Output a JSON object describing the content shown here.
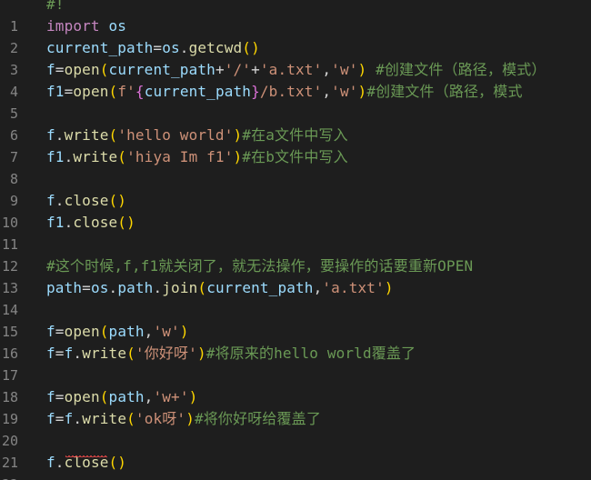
{
  "lines": [
    {
      "num": "",
      "tokens": [
        {
          "t": "#!",
          "c": "cm"
        }
      ]
    },
    {
      "num": "1",
      "tokens": [
        {
          "t": "import",
          "c": "kw"
        },
        {
          "t": " ",
          "c": ""
        },
        {
          "t": "os",
          "c": "var"
        }
      ]
    },
    {
      "num": "2",
      "tokens": [
        {
          "t": "current_path",
          "c": "var"
        },
        {
          "t": "=",
          "c": ""
        },
        {
          "t": "os",
          "c": "var"
        },
        {
          "t": ".",
          "c": ""
        },
        {
          "t": "getcwd",
          "c": "fn"
        },
        {
          "t": "()",
          "c": "br1"
        }
      ]
    },
    {
      "num": "3",
      "tokens": [
        {
          "t": "f",
          "c": "var"
        },
        {
          "t": "=",
          "c": ""
        },
        {
          "t": "open",
          "c": "fn"
        },
        {
          "t": "(",
          "c": "br1"
        },
        {
          "t": "current_path",
          "c": "var"
        },
        {
          "t": "+",
          "c": ""
        },
        {
          "t": "'/'",
          "c": "str"
        },
        {
          "t": "+",
          "c": ""
        },
        {
          "t": "'a.txt'",
          "c": "str"
        },
        {
          "t": ",",
          "c": ""
        },
        {
          "t": "'w'",
          "c": "str"
        },
        {
          "t": ")",
          "c": "br1"
        },
        {
          "t": " #创建文件（路径，模式）",
          "c": "cm"
        }
      ]
    },
    {
      "num": "4",
      "tokens": [
        {
          "t": "f1",
          "c": "var"
        },
        {
          "t": "=",
          "c": ""
        },
        {
          "t": "open",
          "c": "fn"
        },
        {
          "t": "(",
          "c": "br1"
        },
        {
          "t": "f'",
          "c": "str"
        },
        {
          "t": "{",
          "c": "br2"
        },
        {
          "t": "current_path",
          "c": "var"
        },
        {
          "t": "}",
          "c": "br2"
        },
        {
          "t": "/b.txt'",
          "c": "str"
        },
        {
          "t": ",",
          "c": ""
        },
        {
          "t": "'w'",
          "c": "str"
        },
        {
          "t": ")",
          "c": "br1"
        },
        {
          "t": "#创建文件（路径，模式",
          "c": "cm"
        }
      ]
    },
    {
      "num": "5",
      "tokens": []
    },
    {
      "num": "6",
      "tokens": [
        {
          "t": "f",
          "c": "var"
        },
        {
          "t": ".",
          "c": ""
        },
        {
          "t": "write",
          "c": "fn"
        },
        {
          "t": "(",
          "c": "br1"
        },
        {
          "t": "'hello world'",
          "c": "str"
        },
        {
          "t": ")",
          "c": "br1"
        },
        {
          "t": "#在a文件中写入",
          "c": "cm"
        }
      ]
    },
    {
      "num": "7",
      "tokens": [
        {
          "t": "f1",
          "c": "var"
        },
        {
          "t": ".",
          "c": ""
        },
        {
          "t": "write",
          "c": "fn"
        },
        {
          "t": "(",
          "c": "br1"
        },
        {
          "t": "'hiya Im f1'",
          "c": "str"
        },
        {
          "t": ")",
          "c": "br1"
        },
        {
          "t": "#在b文件中写入",
          "c": "cm"
        }
      ]
    },
    {
      "num": "8",
      "tokens": []
    },
    {
      "num": "9",
      "tokens": [
        {
          "t": "f",
          "c": "var"
        },
        {
          "t": ".",
          "c": ""
        },
        {
          "t": "close",
          "c": "fn"
        },
        {
          "t": "()",
          "c": "br1"
        }
      ]
    },
    {
      "num": "10",
      "tokens": [
        {
          "t": "f1",
          "c": "var"
        },
        {
          "t": ".",
          "c": ""
        },
        {
          "t": "close",
          "c": "fn"
        },
        {
          "t": "()",
          "c": "br1"
        }
      ]
    },
    {
      "num": "11",
      "tokens": []
    },
    {
      "num": "12",
      "tokens": [
        {
          "t": "#这个时候,f,f1就关闭了，就无法操作，要操作的话要重新OPEN",
          "c": "cm"
        }
      ]
    },
    {
      "num": "13",
      "tokens": [
        {
          "t": "path",
          "c": "var"
        },
        {
          "t": "=",
          "c": ""
        },
        {
          "t": "os",
          "c": "var"
        },
        {
          "t": ".",
          "c": ""
        },
        {
          "t": "path",
          "c": "var"
        },
        {
          "t": ".",
          "c": ""
        },
        {
          "t": "join",
          "c": "fn"
        },
        {
          "t": "(",
          "c": "br1"
        },
        {
          "t": "current_path",
          "c": "var"
        },
        {
          "t": ",",
          "c": ""
        },
        {
          "t": "'a.txt'",
          "c": "str"
        },
        {
          "t": ")",
          "c": "br1"
        }
      ]
    },
    {
      "num": "14",
      "tokens": []
    },
    {
      "num": "15",
      "tokens": [
        {
          "t": "f",
          "c": "var"
        },
        {
          "t": "=",
          "c": ""
        },
        {
          "t": "open",
          "c": "fn"
        },
        {
          "t": "(",
          "c": "br1"
        },
        {
          "t": "path",
          "c": "var"
        },
        {
          "t": ",",
          "c": ""
        },
        {
          "t": "'w'",
          "c": "str"
        },
        {
          "t": ")",
          "c": "br1"
        }
      ]
    },
    {
      "num": "16",
      "tokens": [
        {
          "t": "f",
          "c": "var"
        },
        {
          "t": "=",
          "c": ""
        },
        {
          "t": "f",
          "c": "var"
        },
        {
          "t": ".",
          "c": ""
        },
        {
          "t": "write",
          "c": "fn"
        },
        {
          "t": "(",
          "c": "br1"
        },
        {
          "t": "'你好呀'",
          "c": "str"
        },
        {
          "t": ")",
          "c": "br1"
        },
        {
          "t": "#将原来的hello world覆盖了",
          "c": "cm"
        }
      ]
    },
    {
      "num": "17",
      "tokens": []
    },
    {
      "num": "18",
      "tokens": [
        {
          "t": "f",
          "c": "var"
        },
        {
          "t": "=",
          "c": ""
        },
        {
          "t": "open",
          "c": "fn"
        },
        {
          "t": "(",
          "c": "br1"
        },
        {
          "t": "path",
          "c": "var"
        },
        {
          "t": ",",
          "c": ""
        },
        {
          "t": "'w+'",
          "c": "str"
        },
        {
          "t": ")",
          "c": "br1"
        }
      ]
    },
    {
      "num": "19",
      "tokens": [
        {
          "t": "f",
          "c": "var"
        },
        {
          "t": "=",
          "c": ""
        },
        {
          "t": "f",
          "c": "var"
        },
        {
          "t": ".",
          "c": ""
        },
        {
          "t": "write",
          "c": "fn"
        },
        {
          "t": "(",
          "c": "br1"
        },
        {
          "t": "'ok呀'",
          "c": "str"
        },
        {
          "t": ")",
          "c": "br1"
        },
        {
          "t": "#将你好呀给覆盖了",
          "c": "cm"
        }
      ]
    },
    {
      "num": "20",
      "tokens": []
    },
    {
      "num": "21",
      "tokens": [
        {
          "t": "f",
          "c": "var"
        },
        {
          "t": ".",
          "c": ""
        },
        {
          "t": "close",
          "c": "fn"
        },
        {
          "t": "()",
          "c": "br1"
        }
      ]
    },
    {
      "num": "22",
      "tokens": []
    }
  ],
  "colors": {
    "background": "#1e1e1e",
    "line_number": "#858585",
    "keyword": "#c586c0",
    "variable": "#9cdcfe",
    "function": "#dcdcaa",
    "string": "#ce9178",
    "comment": "#6a9955",
    "bracket": "#ffd700",
    "error_squiggle": "#f14c4c"
  }
}
